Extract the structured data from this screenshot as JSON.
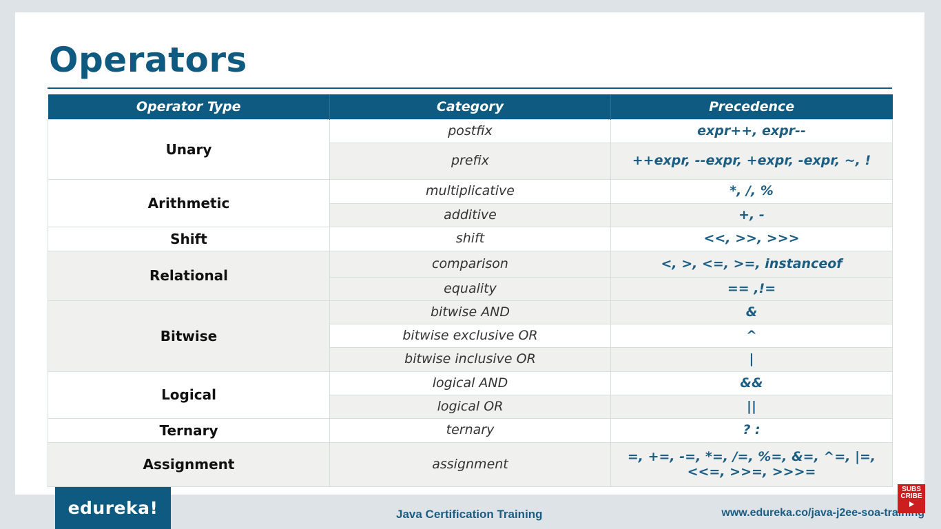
{
  "slide": {
    "title": "Operators"
  },
  "table": {
    "headers": [
      "Operator Type",
      "Category",
      "Precedence"
    ],
    "groups": [
      {
        "type": "Unary",
        "rows": [
          {
            "category": "postfix",
            "precedence": "expr++, expr--"
          },
          {
            "category": "prefix",
            "precedence": "++expr, --expr, +expr, -expr, ~, !"
          }
        ]
      },
      {
        "type": "Arithmetic",
        "rows": [
          {
            "category": "multiplicative",
            "precedence": "*, /, %"
          },
          {
            "category": "additive",
            "precedence": "+, -"
          }
        ]
      },
      {
        "type": "Shift",
        "rows": [
          {
            "category": "shift",
            "precedence": "<<, >>, >>>"
          }
        ]
      },
      {
        "type": "Relational",
        "rows": [
          {
            "category": "comparison",
            "precedence": "<, >, <=, >=, instanceof"
          },
          {
            "category": "equality",
            "precedence": "== ,!="
          }
        ]
      },
      {
        "type": "Bitwise",
        "rows": [
          {
            "category": "bitwise AND",
            "precedence": "&"
          },
          {
            "category": "bitwise exclusive OR",
            "precedence": "^"
          },
          {
            "category": "bitwise inclusive OR",
            "precedence": "|"
          }
        ]
      },
      {
        "type": "Logical",
        "rows": [
          {
            "category": "logical AND",
            "precedence": "&&"
          },
          {
            "category": "logical OR",
            "precedence": "||"
          }
        ]
      },
      {
        "type": "Ternary",
        "rows": [
          {
            "category": "ternary",
            "precedence": "? :"
          }
        ]
      },
      {
        "type": "Assignment",
        "rows": [
          {
            "category": "assignment",
            "precedence": "=, +=, -=, *=, /=, %=, &=, ^=, |=, <<=, >>=, >>>="
          }
        ]
      }
    ]
  },
  "footer": {
    "logo": "edureka!",
    "course": "Java Certification Training",
    "url": "www.edureka.co/java-j2ee-soa-training"
  },
  "subscribe_badge": {
    "line1": "SUBS",
    "line2": "CRIBE"
  },
  "colors": {
    "brand": "#0f5a80",
    "precedence_text": "#1c5d83",
    "shaded_row": "#f0f1ee",
    "subscribe_red": "#cc1e1e"
  }
}
